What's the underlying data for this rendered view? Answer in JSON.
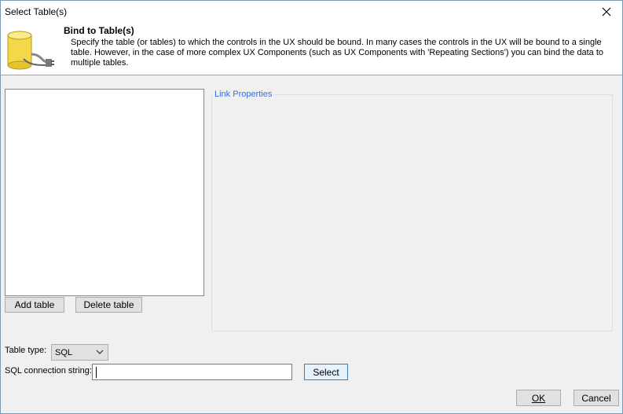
{
  "window": {
    "title": "Select Table(s)"
  },
  "header": {
    "title": "Bind to Table(s)",
    "description": "Specify the table (or tables) to which the controls in the UX should be bound. In many cases the controls in the UX will be bound to a single table. However, in the case of more complex UX Components (such as UX Components with 'Repeating Sections') you can bind the data to multiple tables.",
    "icon": "database-plug-icon"
  },
  "tables": {
    "items": []
  },
  "buttons": {
    "add_table": "Add table",
    "delete_table": "Delete table",
    "select": "Select",
    "ok": "OK",
    "cancel": "Cancel"
  },
  "link_properties": {
    "legend": "Link Properties"
  },
  "table_type": {
    "label": "Table type:",
    "value": "SQL"
  },
  "connection": {
    "label": "SQL connection string:",
    "value": ""
  },
  "colors": {
    "legend_text": "#3c6dd6",
    "button_face": "#e1e1e1",
    "default_button_border": "#3c7fb1"
  }
}
